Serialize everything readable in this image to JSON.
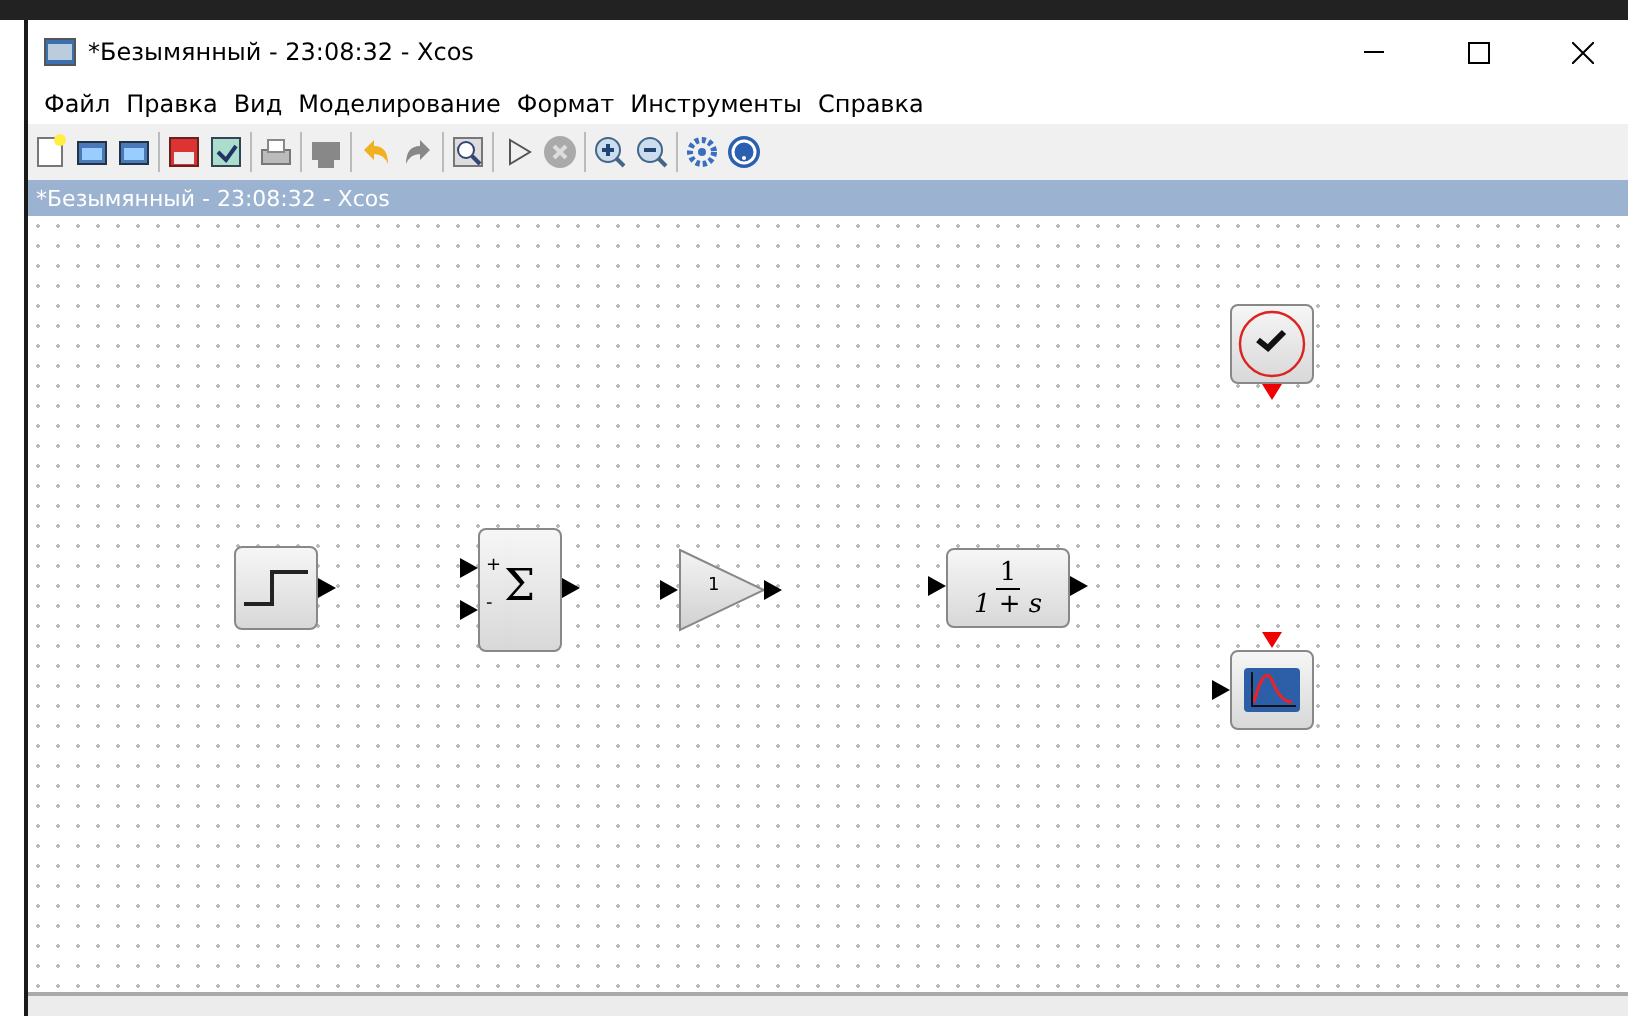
{
  "window": {
    "title": "*Безымянный - 23:08:32 - Xcos"
  },
  "menu": [
    "Файл",
    "Правка",
    "Вид",
    "Моделирование",
    "Формат",
    "Инструменты",
    "Справка"
  ],
  "diagram": {
    "title": "*Безымянный - 23:08:32 - Xcos",
    "blocks": [
      {
        "kind": "step"
      },
      {
        "kind": "sum",
        "signs": [
          "+",
          "-"
        ],
        "symbol": "Σ"
      },
      {
        "kind": "gain",
        "value": "1"
      },
      {
        "kind": "transfer",
        "numerator": "1",
        "denominator": "1 + s"
      },
      {
        "kind": "clock"
      },
      {
        "kind": "scope"
      }
    ]
  }
}
